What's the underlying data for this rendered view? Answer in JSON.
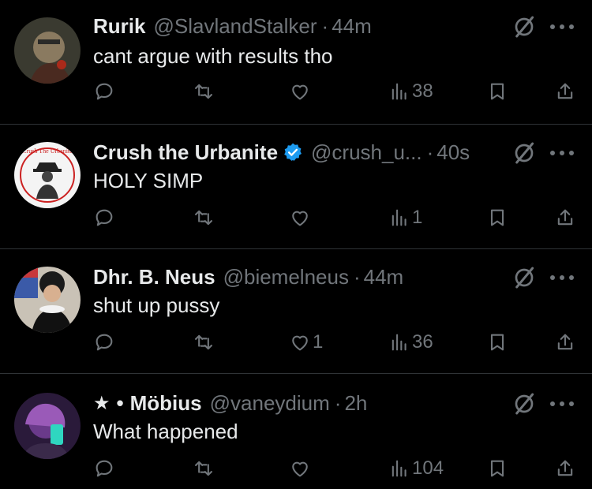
{
  "tweets": [
    {
      "name": "Rurik",
      "handle": "@SlavlandStalker",
      "dot": "·",
      "time": "44m",
      "text": "cant argue with results tho",
      "likes": "",
      "views": "38",
      "verified": false
    },
    {
      "name": "Crush the Urbanite",
      "handle": "@crush_u...",
      "dot": "·",
      "time": "40s",
      "text": "HOLY SIMP",
      "likes": "",
      "views": "1",
      "verified": true,
      "avatar_text": "Crush The Urbanite"
    },
    {
      "name": "Dhr. B. Neus",
      "handle": "@biemelneus",
      "dot": "·",
      "time": "44m",
      "text": "shut up pussy",
      "likes": "1",
      "views": "36",
      "verified": false
    },
    {
      "name": "Möbius",
      "prefix_star": "★",
      "prefix_bullet": "•",
      "handle": "@vaneydium",
      "dot": "·",
      "time": "2h",
      "text": "What happened",
      "likes": "",
      "views": "104",
      "verified": false
    }
  ],
  "colors": {
    "background": "#000000",
    "text": "#e7e9ea",
    "muted": "#71767b",
    "divider": "#2f3336",
    "verified": "#1d9bf0"
  },
  "icons": [
    "reply-icon",
    "retweet-icon",
    "like-icon",
    "views-icon",
    "bookmark-icon",
    "share-icon",
    "grok-icon",
    "more-icon",
    "verified-badge-icon"
  ]
}
